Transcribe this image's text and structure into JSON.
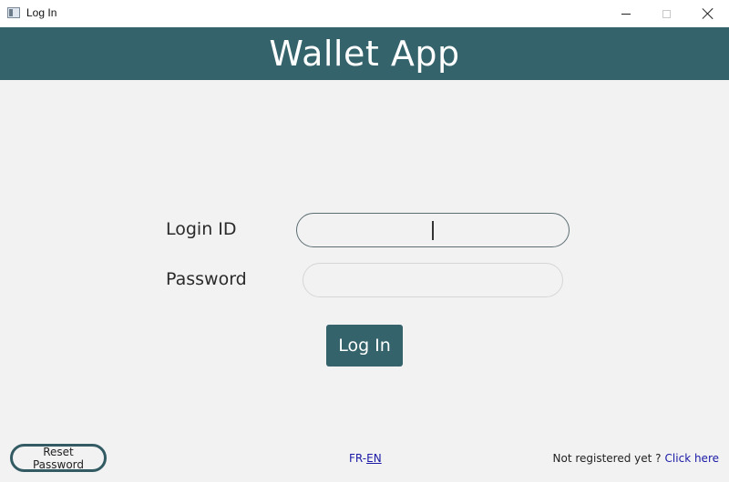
{
  "window": {
    "title": "Log In"
  },
  "header": {
    "title": "Wallet App"
  },
  "form": {
    "login_label": "Login ID",
    "login_value": "",
    "password_label": "Password",
    "password_value": "",
    "submit_label": "Log In"
  },
  "footer": {
    "reset_label": "Reset Password",
    "lang_fr": "FR",
    "lang_sep": "-",
    "lang_en": "EN",
    "register_text": "Not registered yet ?",
    "register_link": "Click here"
  },
  "colors": {
    "header_bg": "#35636b",
    "page_bg": "#f2f2f3",
    "link": "#1a1aa6"
  },
  "icons": {
    "app": "app-window-icon",
    "minimize": "minimize-icon",
    "maximize": "maximize-icon",
    "close": "close-icon"
  }
}
